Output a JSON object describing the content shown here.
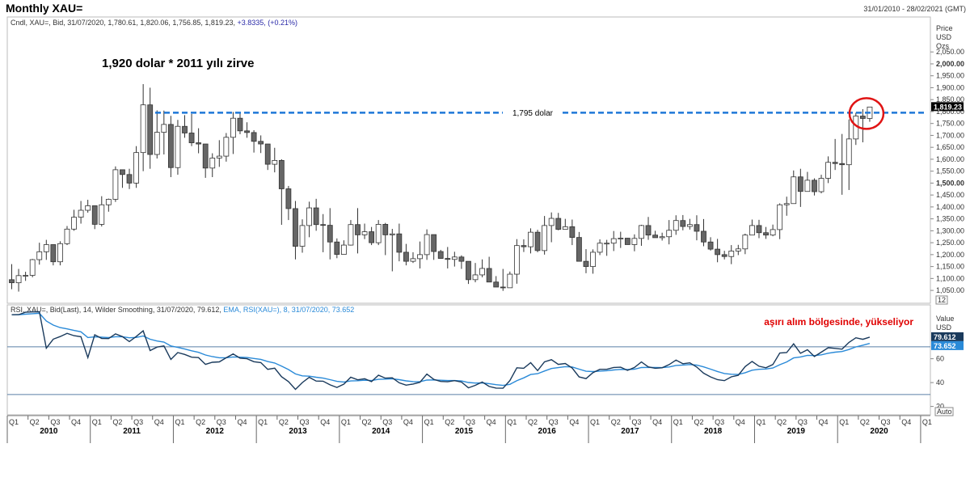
{
  "header": {
    "title": "Monthly XAU=",
    "date_range": "31/01/2010 - 28/02/2021 (GMT)"
  },
  "price_panel": {
    "legend_prefix": "Cndl, XAU=, Bid, 31/07/2020, 1,780.61, 1,820.06, 1,756.85, 1,819.23,",
    "legend_change": "+3.8335, (+0.21%)",
    "axis_title": [
      "Price",
      "USD",
      "Ozs"
    ],
    "last_price_tag": "1,819.23",
    "annotation_peak": "1,920 dolar * 2011 yılı zirve",
    "annotation_level": "1,795 dolar",
    "scale_box": "12"
  },
  "rsi_panel": {
    "legend_prefix": "RSI, XAU=, Bid(Last),  14,  Wilder Smoothing, 31/07/2020, 79.612,",
    "legend_ema": "EMA, RSI(XAU=),  8, 31/07/2020, 73.652",
    "axis_title": [
      "Value",
      "USD"
    ],
    "annotation": "aşırı alım bölgesinde, yükseliyor",
    "rsi_tag": "79.612",
    "ema_tag": "73.652",
    "auto_box": "Auto"
  },
  "chart_data": [
    {
      "type": "candlestick",
      "title": "Monthly XAU=",
      "ylabel": "Price USD Ozs",
      "ylim": [
        1030,
        2105
      ],
      "yticks": [
        "1,050.00",
        "1,100.00",
        "1,150.00",
        "1,200.00",
        "1,250.00",
        "1,300.00",
        "1,350.00",
        "1,400.00",
        "1,450.00",
        "1,500.00",
        "1,550.00",
        "1,600.00",
        "1,650.00",
        "1,700.00",
        "1,750.00",
        "1,800.00",
        "1,850.00",
        "1,900.00",
        "1,950.00",
        "2,000.00",
        "2,050.00"
      ],
      "ytick_values": [
        1050,
        1100,
        1150,
        1200,
        1250,
        1300,
        1350,
        1400,
        1450,
        1500,
        1550,
        1600,
        1650,
        1700,
        1750,
        1800,
        1850,
        1900,
        1950,
        2000,
        2050
      ],
      "bold_ticks": [
        1500,
        2000
      ],
      "horizontal_level": 1795,
      "start": "2010-01",
      "closes": [
        1082,
        1112,
        1113,
        1179,
        1212,
        1242,
        1170,
        1246,
        1307,
        1357,
        1386,
        1405,
        1327,
        1409,
        1432,
        1556,
        1536,
        1500,
        1628,
        1828,
        1620,
        1713,
        1746,
        1565,
        1738,
        1710,
        1669,
        1664,
        1563,
        1605,
        1613,
        1692,
        1772,
        1719,
        1712,
        1675,
        1664,
        1579,
        1595,
        1476,
        1393,
        1235,
        1322,
        1396,
        1326,
        1323,
        1253,
        1201,
        1240,
        1326,
        1283,
        1296,
        1250,
        1327,
        1283,
        1287,
        1210,
        1172,
        1183,
        1200,
        1284,
        1213,
        1184,
        1180,
        1190,
        1172,
        1095,
        1115,
        1142,
        1085,
        1064,
        1061,
        1118,
        1238,
        1233,
        1294,
        1217,
        1322,
        1352,
        1306,
        1317,
        1272,
        1172,
        1150,
        1210,
        1248,
        1248,
        1267,
        1269,
        1242,
        1268,
        1322,
        1282,
        1271,
        1275,
        1302,
        1343,
        1318,
        1326,
        1298,
        1253,
        1223,
        1200,
        1192,
        1215,
        1224,
        1282,
        1322,
        1292,
        1282,
        1305,
        1409,
        1414,
        1526,
        1465,
        1512,
        1464,
        1520,
        1587,
        1582,
        1577,
        1685,
        1781,
        1771,
        1819
      ],
      "highs": [
        1160,
        1140,
        1128,
        1182,
        1250,
        1262,
        1230,
        1256,
        1320,
        1388,
        1425,
        1430,
        1384,
        1445,
        1435,
        1570,
        1550,
        1560,
        1655,
        1915,
        1900,
        1805,
        1804,
        1782,
        1765,
        1785,
        1790,
        1730,
        1643,
        1625,
        1680,
        1710,
        1798,
        1795,
        1755,
        1722,
        1700,
        1618,
        1648,
        1600,
        1488,
        1425,
        1348,
        1422,
        1434,
        1370,
        1395,
        1268,
        1260,
        1345,
        1395,
        1330,
        1316,
        1345,
        1333,
        1308,
        1330,
        1245,
        1210,
        1255,
        1306,
        1223,
        1220,
        1232,
        1212,
        1197,
        1171,
        1165,
        1180,
        1191,
        1110,
        1140,
        1129,
        1265,
        1264,
        1310,
        1304,
        1362,
        1377,
        1375,
        1350,
        1347,
        1295,
        1223,
        1222,
        1264,
        1262,
        1299,
        1296,
        1270,
        1285,
        1325,
        1358,
        1300,
        1292,
        1345,
        1365,
        1366,
        1350,
        1365,
        1349,
        1273,
        1266,
        1216,
        1240,
        1241,
        1288,
        1347,
        1346,
        1316,
        1326,
        1415,
        1443,
        1553,
        1560,
        1547,
        1520,
        1535,
        1612,
        1685,
        1706,
        1767,
        1795,
        1810,
        1820
      ],
      "lows": [
        1055,
        1045,
        1090,
        1105,
        1158,
        1178,
        1155,
        1155,
        1240,
        1300,
        1330,
        1376,
        1307,
        1318,
        1380,
        1421,
        1480,
        1475,
        1480,
        1550,
        1560,
        1603,
        1620,
        1525,
        1535,
        1690,
        1655,
        1625,
        1522,
        1525,
        1568,
        1590,
        1622,
        1705,
        1690,
        1628,
        1626,
        1555,
        1545,
        1325,
        1345,
        1180,
        1208,
        1273,
        1300,
        1210,
        1180,
        1185,
        1202,
        1238,
        1205,
        1265,
        1240,
        1240,
        1198,
        1130,
        1172,
        1155,
        1165,
        1142,
        1178,
        1178,
        1183,
        1142,
        1150,
        1140,
        1077,
        1084,
        1105,
        1093,
        1072,
        1048,
        1062,
        1078,
        1211,
        1205,
        1210,
        1200,
        1252,
        1302,
        1305,
        1240,
        1171,
        1122,
        1120,
        1198,
        1195,
        1215,
        1228,
        1243,
        1214,
        1237,
        1262,
        1276,
        1259,
        1243,
        1283,
        1302,
        1305,
        1260,
        1235,
        1217,
        1168,
        1180,
        1160,
        1198,
        1202,
        1283,
        1269,
        1266,
        1277,
        1265,
        1363,
        1438,
        1400,
        1470,
        1448,
        1457,
        1500,
        1555,
        1451,
        1471,
        1660,
        1671,
        1757
      ],
      "first_open": 1095
    },
    {
      "type": "line",
      "title": "RSI, XAU=, Bid(Last),  14,  Wilder Smoothing",
      "ylabel": "Value USD",
      "ylim": [
        15,
        95
      ],
      "yticks": [
        20,
        40,
        60
      ],
      "overbought": 70,
      "oversold": 30,
      "start": "2010-01",
      "series": [
        {
          "name": "RSI",
          "color": "#1a3a5c"
        },
        {
          "name": "EMA",
          "color": "#2a8ad8"
        }
      ]
    }
  ],
  "x_axis": {
    "quarter_labels": [
      "Q1",
      "Q2",
      "Q3",
      "Q4"
    ],
    "years": [
      "2010",
      "2011",
      "2012",
      "2013",
      "2014",
      "2015",
      "2016",
      "2017",
      "2018",
      "2019",
      "2020"
    ],
    "end_quarter": "Q1"
  },
  "colors": {
    "up_candle": "#ffffff",
    "down_candle": "#666666",
    "candle_outline": "#333333",
    "level_line": "#1e78d8",
    "circle": "#e01414",
    "rsi_line": "#1a3a5c",
    "ema_line": "#2a8ad8",
    "band_line": "#5a7fa8",
    "tag_bg": "#000000",
    "rsi_tag_bg": "#1a3a5c",
    "ema_tag_bg": "#2a8ad8"
  }
}
